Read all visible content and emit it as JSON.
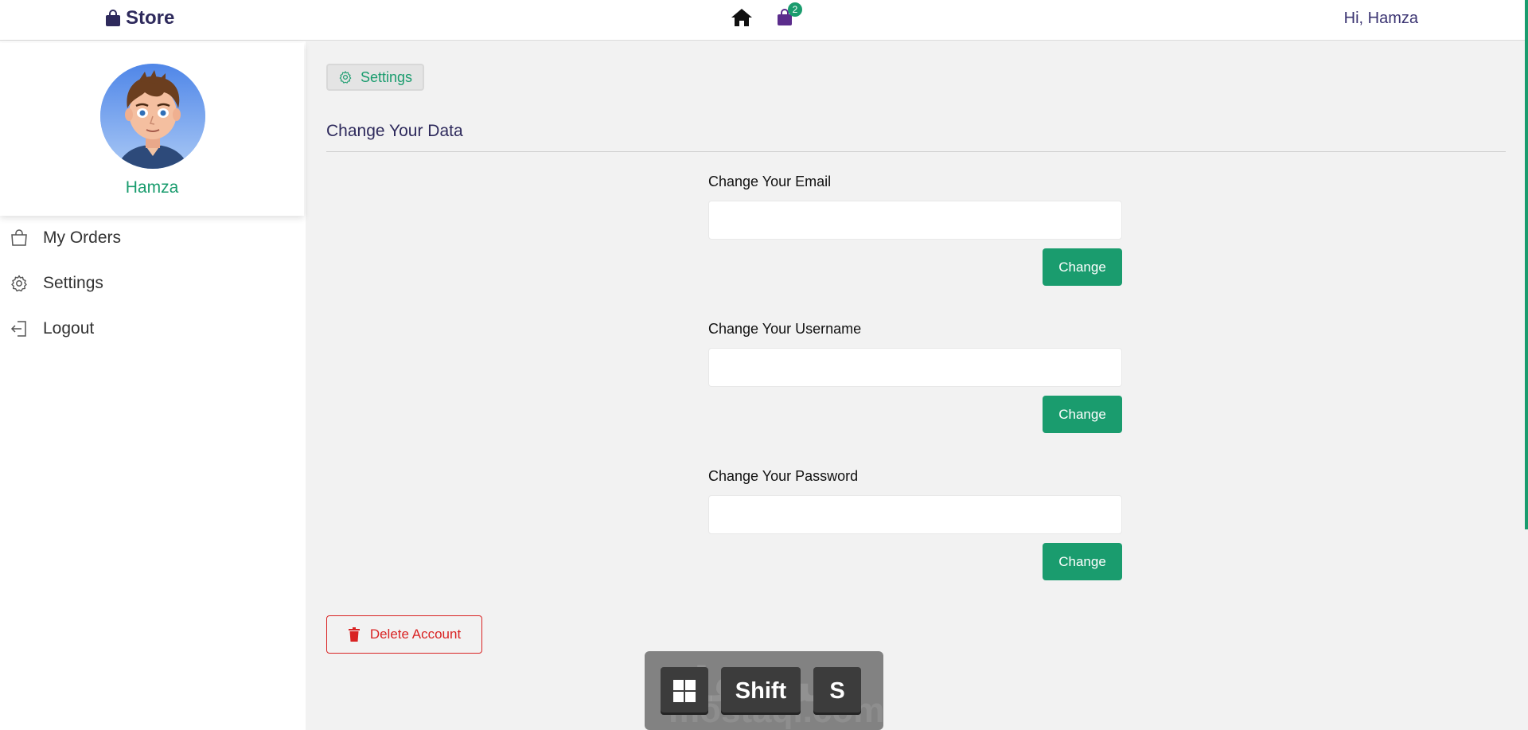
{
  "navbar": {
    "brand": "Store",
    "cart_count": "2",
    "greeting": "Hi, Hamza",
    "icons": {
      "brand": "shopping-bag-icon",
      "home": "home-icon",
      "cart": "shopping-bag-icon"
    }
  },
  "sidebar": {
    "profile_name": "Hamza",
    "items": [
      {
        "label": "My Orders",
        "icon": "shopping-bag-outline-icon"
      },
      {
        "label": "Settings",
        "icon": "gear-icon"
      },
      {
        "label": "Logout",
        "icon": "logout-icon"
      }
    ]
  },
  "main": {
    "breadcrumb": "Settings",
    "section_title": "Change Your Data",
    "forms": [
      {
        "label": "Change Your Email",
        "value": "",
        "button": "Change"
      },
      {
        "label": "Change Your Username",
        "value": "",
        "button": "Change"
      },
      {
        "label": "Change Your Password",
        "value": "",
        "button": "Change"
      }
    ],
    "delete_button": "Delete Account"
  },
  "keyboard_overlay": {
    "keys": [
      "Shift",
      "S"
    ],
    "watermark": "مستقل",
    "watermark_latin": "mostaql.com"
  },
  "colors": {
    "accent": "#1a9c6e",
    "brand": "#2e2a5c",
    "danger": "#d92323",
    "background": "#f2f2f2"
  }
}
